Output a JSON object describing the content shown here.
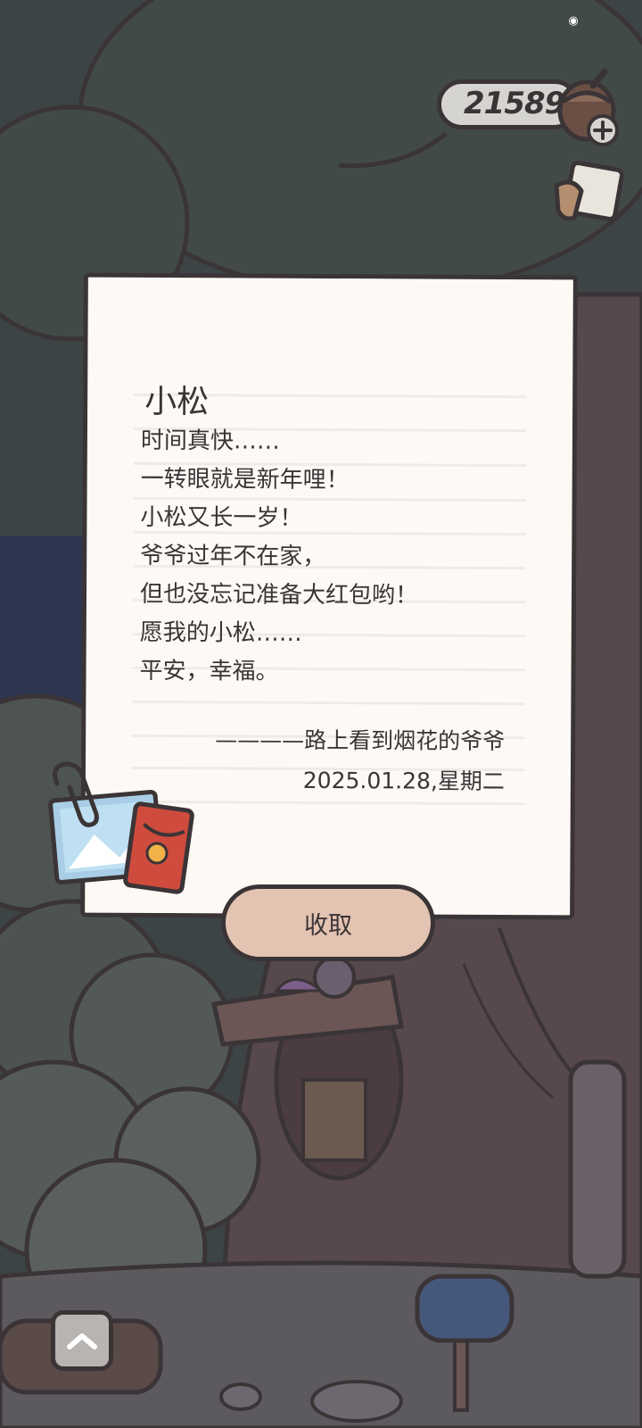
{
  "status_bar": {
    "icon": "cat-face-icon"
  },
  "currency": {
    "value": "21589",
    "icon": "acorn-icon",
    "add_icon": "plus-icon"
  },
  "side_buttons": [
    {
      "icon": "notebook-icon"
    }
  ],
  "letter": {
    "greeting": "小松",
    "lines": [
      "时间真快……",
      "一转眼就是新年哩！",
      "小松又长一岁！",
      "爷爷过年不在家，",
      "但也没忘记准备大红包哟！",
      "愿我的小松……",
      "平安，幸福。"
    ],
    "signature": "————路上看到烟花的爷爷",
    "date": "2025.01.28,星期二",
    "attachments": [
      "photo-icon",
      "red-envelope-icon",
      "paper-clip-icon"
    ]
  },
  "collect_button": {
    "label": "收取"
  },
  "bottom_controls": {
    "expand_icon": "chevron-up-icon"
  },
  "colors": {
    "outline": "#3b3436",
    "paper": "#fdfaf6",
    "button": "#e3c3b2",
    "tree_canopy": "#3f4745",
    "trunk": "#56484d",
    "red_envelope": "#cf4b3e"
  }
}
